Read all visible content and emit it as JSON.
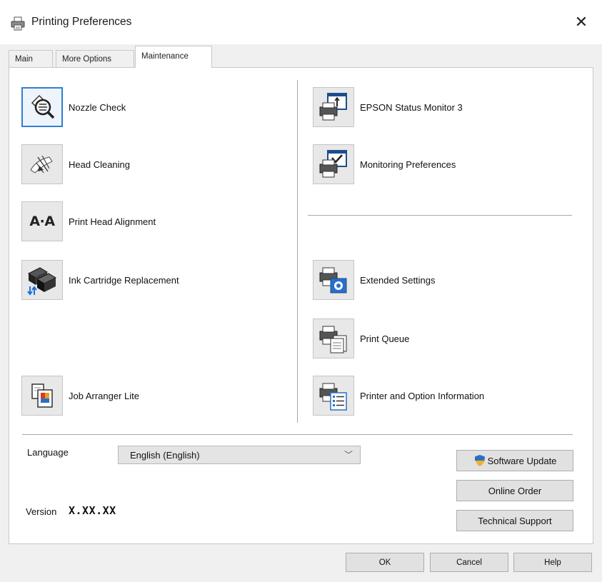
{
  "window": {
    "title": "Printing Preferences",
    "close_label": "✕",
    "title_icon": "printer-icon"
  },
  "tabs": [
    {
      "label": "Main",
      "active": false
    },
    {
      "label": "More Options",
      "active": false
    },
    {
      "label": "Maintenance",
      "active": true
    }
  ],
  "left_items": [
    {
      "label": "Nozzle Check",
      "icon": "nozzle-check-icon",
      "selected": true
    },
    {
      "label": "Head Cleaning",
      "icon": "head-cleaning-icon",
      "selected": false
    },
    {
      "label": "Print Head Alignment",
      "icon": "print-head-alignment-icon",
      "selected": false
    },
    {
      "label": "Ink Cartridge Replacement",
      "icon": "ink-cartridge-icon",
      "selected": false
    },
    {
      "label": "Job Arranger Lite",
      "icon": "job-arranger-icon",
      "selected": false
    }
  ],
  "right_items": [
    {
      "label": "EPSON Status Monitor 3",
      "icon": "status-monitor-icon"
    },
    {
      "label": "Monitoring Preferences",
      "icon": "monitoring-preferences-icon"
    },
    {
      "label": "Extended Settings",
      "icon": "extended-settings-icon"
    },
    {
      "label": "Print Queue",
      "icon": "print-queue-icon"
    },
    {
      "label": "Printer and Option Information",
      "icon": "printer-info-icon"
    }
  ],
  "print_head_alignment_glyph": "A·A",
  "language": {
    "label": "Language",
    "value": "English (English)",
    "arrow": "﹀"
  },
  "version": {
    "label": "Version",
    "value": "X.XX.XX"
  },
  "side_buttons": {
    "software_update": "Software Update",
    "online_order": "Online Order",
    "technical_support": "Technical Support"
  },
  "dialog_buttons": {
    "ok": "OK",
    "cancel": "Cancel",
    "help": "Help"
  },
  "colors": {
    "selection_border": "#2f7fd1",
    "shield_blue": "#2a6fc9",
    "shield_gold": "#f0b323"
  }
}
